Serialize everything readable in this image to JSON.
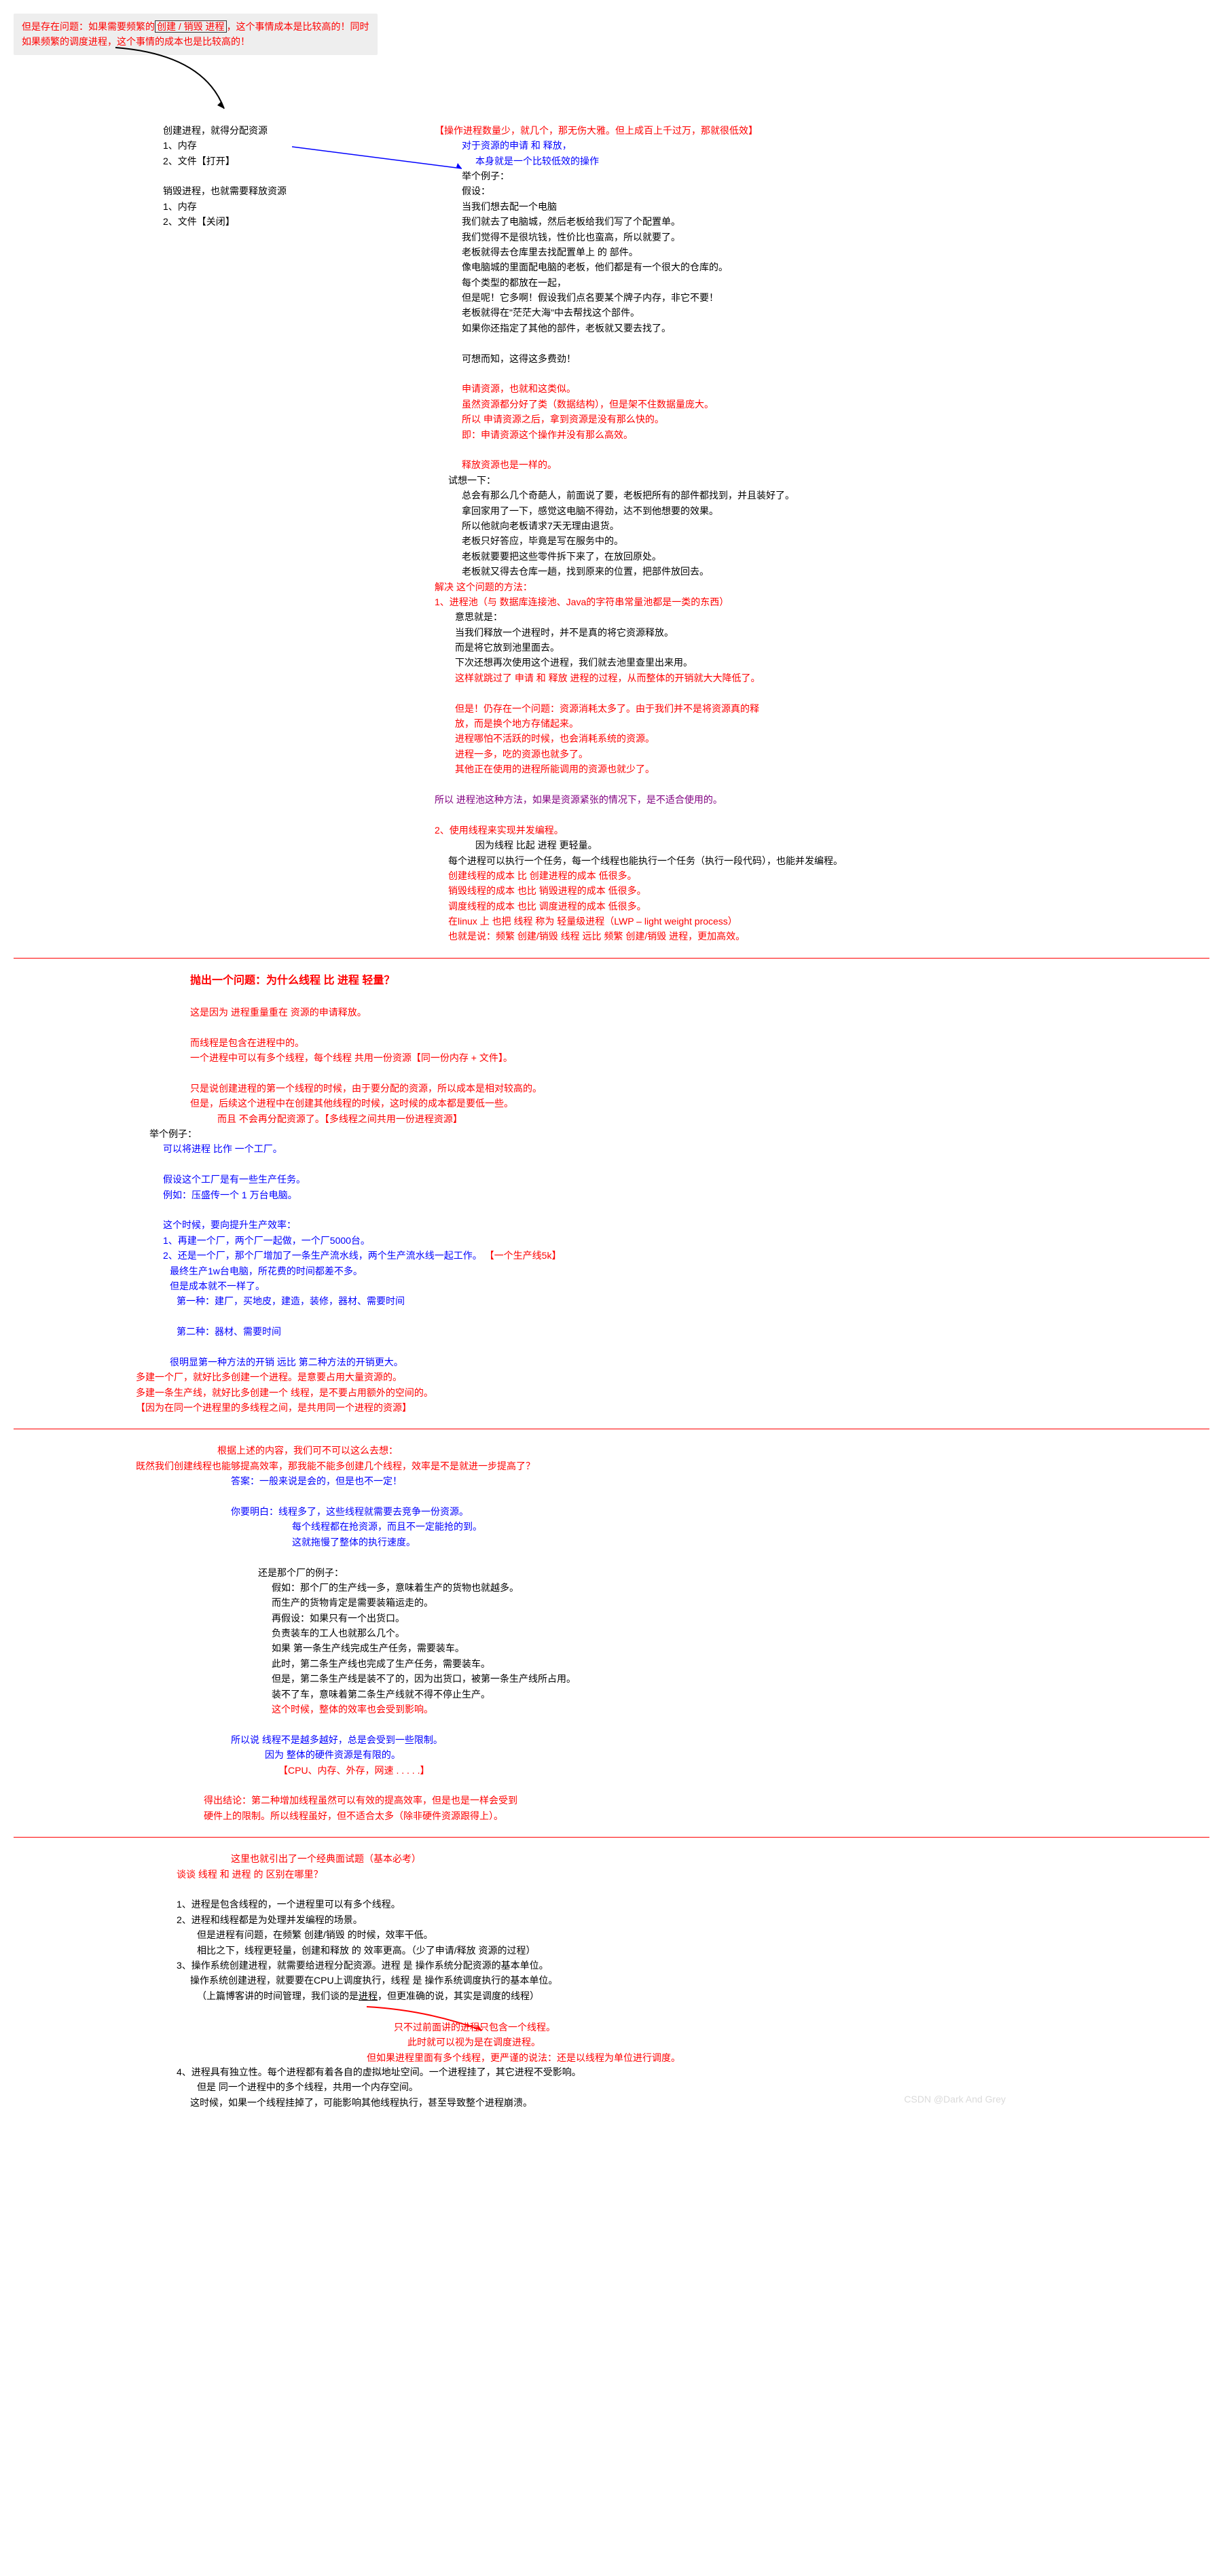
{
  "top_note": {
    "line1a": "但是存在问题：如果需要频繁的",
    "line1b": "创建 / 销毁 进程",
    "line1c": "，这个事情成本是比较高的！同时",
    "line2": "如果频繁的调度进程，这个事情的成本也是比较高的！"
  },
  "section1": {
    "create_title": "创建进程，就得分配资源",
    "create_1": "1、内存",
    "create_2": "2、文件【打开】",
    "destroy_title": "销毁进程，也就需要释放资源",
    "destroy_1": "1、内存",
    "destroy_2": "2、文件【关闭】",
    "right1": "【操作进程数量少，就几个，那无伤大雅。但上成百上千过万，那就很低效】",
    "right2": "对于资源的申请 和 释放，",
    "right3": "本身就是一个比较低效的操作",
    "ex_title": "举个例子：",
    "ex_1": "假设：",
    "ex_2": "当我们想去配一个电脑",
    "ex_3": "我们就去了电脑城，然后老板给我们写了个配置单。",
    "ex_4": "我们觉得不是很坑钱，性价比也蛮高，所以就要了。",
    "ex_5": "老板就得去仓库里去找配置单上 的 部件。",
    "ex_6": "像电脑城的里面配电脑的老板，他们都是有一个很大的仓库的。",
    "ex_7": "每个类型的都放在一起，",
    "ex_8": "但是呢！它多啊！假设我们点名要某个牌子内存，非它不要！",
    "ex_9": "老板就得在\"茫茫大海\"中去帮找这个部件。",
    "ex_10": "如果你还指定了其他的部件，老板就又要去找了。",
    "ex_blank": "",
    "ex_11": "可想而知，这得这多费劲！",
    "red_block1_1": "申请资源，也就和这类似。",
    "red_block1_2": "虽然资源都分好了类（数据结构），但是架不住数据量庞大。",
    "red_block1_3": "所以 申请资源之后，拿到资源是没有那么快的。",
    "red_block1_4": "即：申请资源这个操作并没有那么高效。",
    "red_block1_5": "释放资源也是一样的。",
    "think_title": "试想一下：",
    "think_1": "总会有那么几个奇葩人，前面说了要，老板把所有的部件都找到，并且装好了。",
    "think_2": "拿回家用了一下，感觉这电脑不得劲，达不到他想要的效果。",
    "think_3": "所以他就向老板请求7天无理由退货。",
    "think_4": "老板只好答应，毕竟是写在服务中的。",
    "think_5": "老板就要要把这些零件拆下来了，在放回原处。",
    "think_6": "老板就又得去仓库一趟，找到原来的位置，把部件放回去。",
    "solve_title": "解决  这个问题的方法：",
    "solve_1": "1、进程池（与 数据库连接池、Java的字符串常量池都是一类的东西）",
    "solve_1_meaning": "意思就是：",
    "solve_1_1": "当我们释放一个进程时，并不是真的将它资源释放。",
    "solve_1_2": "而是将它放到池里面去。",
    "solve_1_3": "下次还想再次使用这个进程，我们就去池里查里出来用。",
    "solve_1_4": "这样就跳过了 申请 和 释放 进程的过程，从而整体的开销就大大降低了。",
    "solve_1_but1": "但是！仍存在一个问题：资源消耗太多了。由于我们并不是将资源真的释",
    "solve_1_but2": "放，而是换个地方存储起来。",
    "solve_1_but3": "进程哪怕不活跃的时候，也会消耗系统的资源。",
    "solve_1_but4": "进程一多，吃的资源也就多了。",
    "solve_1_but5": "其他正在使用的进程所能调用的资源也就少了。",
    "solve_1_conclude": "所以 进程池这种方法，如果是资源紧张的情况下，是不适合使用的。",
    "solve_2": "2、使用线程来实现并发编程。",
    "solve_2_sub": "因为线程 比起 进程 更轻量。",
    "solve_2_1": "每个进程可以执行一个任务，每一个线程也能执行一个任务（执行一段代码），也能并发编程。",
    "solve_2_2": "创建线程的成本 比 创建进程的成本 低很多。",
    "solve_2_3": "销毁线程的成本 也比 销毁进程的成本 低很多。",
    "solve_2_4": "调度线程的成本 也比 调度进程的成本 低很多。",
    "solve_2_5": "在linux 上 也把 线程 称为 轻量级进程（LWP – light weight process）",
    "solve_2_6": "也就是说：频繁 创建/销毁 线程 远比 频繁 创建/销毁 进程，更加高效。"
  },
  "q1": {
    "title": "抛出一个问题：为什么线程 比 进程 轻量？",
    "p1": "这是因为 进程重量重在 资源的申请释放。",
    "p2": "而线程是包含在进程中的。",
    "p3": "一个进程中可以有多个线程，每个线程 共用一份资源【同一份内存 + 文件】。",
    "p4": "只是说创建进程的第一个线程的时候，由于要分配的资源，所以成本是相对较高的。",
    "p5": "但是，后续这个进程中在创建其他线程的时候，这时候的成本都是要低一些。",
    "p6": "而且 不会再分配资源了。【多线程之间共用一份进程资源】",
    "ex_title": "举个例子：",
    "ex_1": "可以将进程 比作 一个工厂。",
    "ex_2": "假设这个工厂是有一些生产任务。",
    "ex_3": "例如：压盛传一个 1 万台电脑。",
    "ex_4": "这个时候，要向提升生产效率：",
    "ex_5a": "1、再建一个厂，两个厂一起做，一个厂5000台。",
    "ex_5b": "2、还是一个厂，那个厂增加了一条生产流水线，两个生产流水线一起工作。",
    "ex_5b_tag": "【一个生产线5k】",
    "ex_6": "最终生产1w台电脑，所花费的时间都差不多。",
    "ex_7": "但是成本就不一样了。",
    "ex_8": "第一种：建厂，买地皮，建造，装修，器材、需要时间",
    "ex_9": "第二种：器材、需要时间",
    "ex_10": "很明显第一种方法的开销 远比 第二种方法的开销更大。",
    "c1": "多建一个厂，就好比多创建一个进程。是意要占用大量资源的。",
    "c2": "多建一条生产线，就好比多创建一个 线程，是不要占用额外的空间的。",
    "c3": "【因为在同一个进程里的多线程之间，是共用同一个进程的资源】"
  },
  "q2": {
    "title1": "根据上述的内容，我们可不可以这么去想：",
    "title2": "既然我们创建线程也能够提高效率，那我能不能多创建几个线程，效率是不是就进一步提高了？",
    "ans": "答案：一般来说是会的，但是也不一定！",
    "b1": "你要明白：线程多了，这些线程就需要去竞争一份资源。",
    "b2": "每个线程都在抢资源，而且不一定能抢的到。",
    "b3": "这就拖慢了整体的执行速度。",
    "ex_t": "还是那个厂的例子：",
    "ex_1": "假如：那个厂的生产线一多，意味着生产的货物也就越多。",
    "ex_2": "而生产的货物肯定是需要装箱运走的。",
    "ex_3": "再假设：如果只有一个出货口。",
    "ex_4": "负责装车的工人也就那么几个。",
    "ex_5": "如果 第一条生产线完成生产任务，需要装车。",
    "ex_6": "此时，第二条生产线也完成了生产任务，需要装车。",
    "ex_7": "但是，第二条生产线是装不了的，因为出货口，被第一条生产线所占用。",
    "ex_8": "装不了车，意味着第二条生产线就不得不停止生产。",
    "ex_9": "这个时候，整体的效率也会受到影响。",
    "so1": "所以说 线程不是越多越好，总是会受到一些限制。",
    "so2": "因为 整体的硬件资源是有限的。",
    "so3": "【CPU、内存、外存，网速 . . . . .】",
    "c1": "得出结论：第二种增加线程虽然可以有效的提高效率，但是也是一样会受到",
    "c2": "硬件上的限制。所以线程虽好，但不适合太多（除非硬件资源跟得上）。"
  },
  "q3": {
    "title": "这里也就引出了一个经典面试题（基本必考）",
    "sub": "谈谈 线程 和 进程 的 区别在哪里？",
    "p1": "1、进程是包含线程的，一个进程里可以有多个线程。",
    "p2": "2、进程和线程都是为处理并发编程的场景。",
    "p2_1": "但是进程有问题，在频繁 创建/销毁 的时候，效率干低。",
    "p2_2": "相比之下，线程更轻量，创建和释放 的 效率更高。（少了申请/释放 资源的过程）",
    "p3": "3、操作系统创建进程，就需要给进程分配资源。进程 是 操作系统分配资源的基本单位。",
    "p3_1": "操作系统创建进程，就要要在CPU上调度执行，线程 是 操作系统调度执行的基本单位。",
    "p3_2a": "（上篇博客讲的时间管理，我们谈的是",
    "p3_2b": "进程",
    "p3_2c": "，但更准确的说，其实是调度的线程）",
    "arrow1": "只不过前面讲的进程只包含一个线程。",
    "arrow2": "此时就可以视为是在调度进程。",
    "arrow3": "但如果进程里面有多个线程，更严谨的说法：还是以线程为单位进行调度。",
    "p4": "4、进程具有独立性。每个进程都有着各自的虚拟地址空间。一个进程挂了，其它进程不受影响。",
    "p4_1": "但是 同一个进程中的多个线程，共用一个内存空间。",
    "p4_2": "这时候，如果一个线程挂掉了，可能影响其他线程执行，甚至导致整个进程崩溃。"
  },
  "watermark": "CSDN @Dark And Grey"
}
